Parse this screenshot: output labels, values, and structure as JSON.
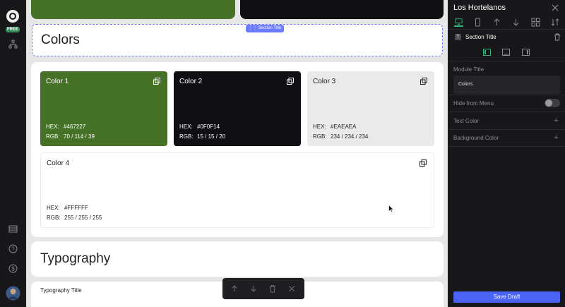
{
  "rail": {
    "badge": "FREE"
  },
  "canvas": {
    "section_tag": "Section Title",
    "colors_title": "Colors",
    "swatches": [
      {
        "name": "Color 1",
        "hex_label": "HEX:",
        "hex": "#467227",
        "rgb_label": "RGB:",
        "rgb": "70 / 114 / 39",
        "bg": "#467227",
        "fg": "#ffffff"
      },
      {
        "name": "Color 2",
        "hex_label": "HEX:",
        "hex": "#0F0F14",
        "rgb_label": "RGB:",
        "rgb": "15 / 15 / 20",
        "bg": "#0F0F14",
        "fg": "#ffffff"
      },
      {
        "name": "Color 3",
        "hex_label": "HEX:",
        "hex": "#EAEAEA",
        "rgb_label": "RGB:",
        "rgb": "234 / 234 / 234",
        "bg": "#EAEAEA",
        "fg": "#1f1f1f"
      },
      {
        "name": "Color 4",
        "hex_label": "HEX:",
        "hex": "#FFFFFF",
        "rgb_label": "RGB:",
        "rgb": "255 / 255 / 255",
        "bg": "#FFFFFF",
        "fg": "#1f1f1f"
      }
    ],
    "typography_title": "Typography",
    "typography_sub": "Typography Title"
  },
  "panel": {
    "title": "Los Hortelanos",
    "module_name": "Section Title",
    "module_title_label": "Module Title",
    "module_title_value": "Colors",
    "hide_from_menu_label": "Hide from Menu",
    "text_color_label": "Text Color",
    "background_color_label": "Background Color",
    "save_label": "Save Draft"
  },
  "colors": {
    "accent": "#4a63f5",
    "brand_green": "#2e8b57",
    "section_outline": "#6c7bff"
  }
}
